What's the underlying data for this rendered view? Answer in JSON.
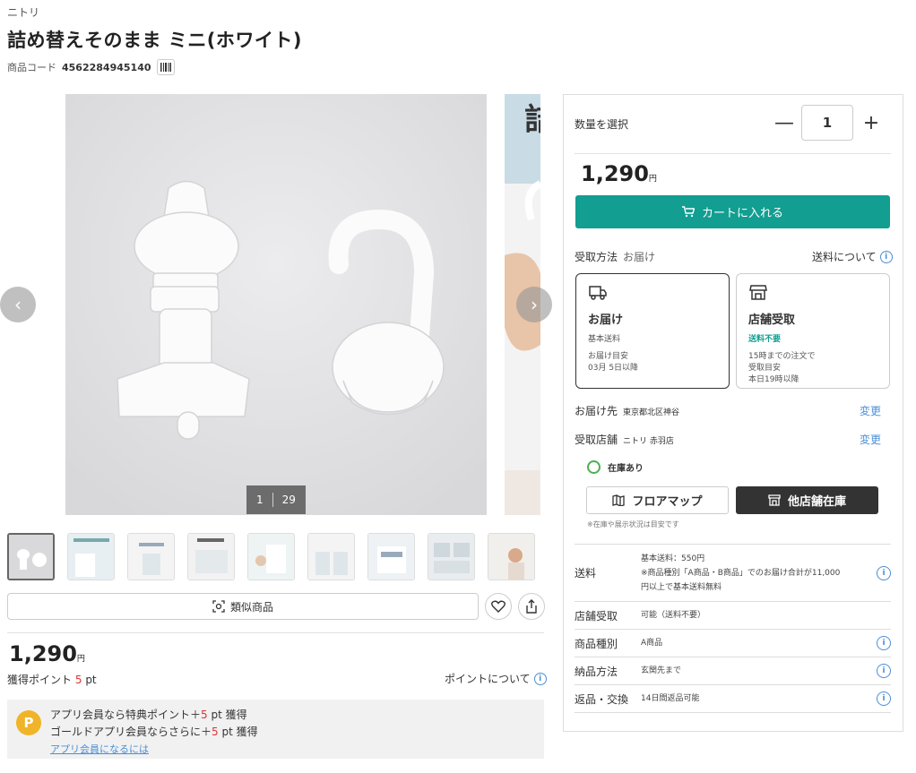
{
  "header": {
    "brand": "ニトリ",
    "title": "詰め替えそのまま ミニ(ホワイト)",
    "code_label": "商品コード",
    "code_value": "4562284945140"
  },
  "gallery": {
    "current": "1",
    "total": "29",
    "prev_icon": "chevron-left-icon",
    "next_icon": "chevron-right-icon"
  },
  "thumbnails": [
    "thumb-1",
    "thumb-2",
    "thumb-3",
    "thumb-4",
    "thumb-5",
    "thumb-6",
    "thumb-7",
    "thumb-8",
    "thumb-9"
  ],
  "actions": {
    "similar_label": "類似商品"
  },
  "price": {
    "value": "1,290",
    "unit": "円"
  },
  "points": {
    "label": "獲得ポイント",
    "value": "5",
    "unit": "pt",
    "link": "ポイントについて"
  },
  "app": {
    "line1_prefix": "アプリ会員なら特典ポイント＋",
    "line1_value": "5",
    "line1_suffix": " pt 獲得",
    "line2_prefix": "ゴールドアプリ会員ならさらに＋",
    "line2_value": "5",
    "line2_suffix": " pt 獲得",
    "link": "アプリ会員になるには",
    "icon_letter": "P"
  },
  "panel": {
    "qty_label": "数量を選択",
    "qty_value": "1",
    "minus": "—",
    "plus": "+",
    "price": "1,290",
    "price_unit": "円",
    "cart_label": "カートに入れる",
    "receive_label": "受取方法",
    "receive_value": "お届け",
    "shipping_link": "送料について",
    "delivery": {
      "title": "お届け",
      "fee": "基本送料",
      "eta_label": "お届け目安",
      "eta": "03月 5日以降"
    },
    "pickup": {
      "title": "店舗受取",
      "fee": "送料不要",
      "l1": "15時までの注文で",
      "l2": "受取目安",
      "l3": "本日19時以降"
    },
    "dest_label": "お届け先",
    "dest_value": "東京都北区神谷",
    "store_label": "受取店舗",
    "store_value": "ニトリ 赤羽店",
    "change": "変更",
    "stock": "在庫あり",
    "floor_map": "フロアマップ",
    "other_stock": "他店舗在庫",
    "note": "※在庫や展示状況は目安です"
  },
  "specs": [
    {
      "k": "送料",
      "v1": "基本送料：550円",
      "v2": "※商品種別「A商品・B商品」でのお届け合計が11,000",
      "v3": "円以上で基本送料無料"
    },
    {
      "k": "店舗受取",
      "v1": "可能（送料不要）"
    },
    {
      "k": "商品種別",
      "v1": "A商品"
    },
    {
      "k": "納品方法",
      "v1": "玄関先まで"
    },
    {
      "k": "返品・交換",
      "v1": "14日間返品可能"
    }
  ],
  "colors": {
    "accent": "#129e91",
    "link": "#4a8fd6",
    "point": "#f0b429",
    "red": "#d33333"
  }
}
